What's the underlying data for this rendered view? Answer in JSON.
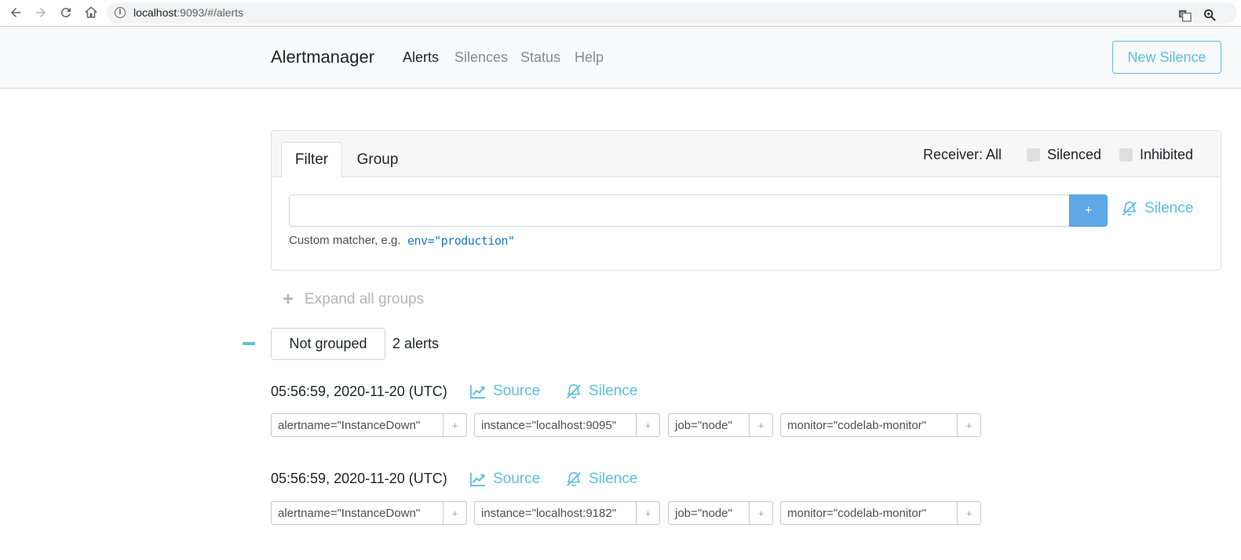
{
  "browser": {
    "url_host": "localhost",
    "url_rest": ":9093/#/alerts"
  },
  "navbar": {
    "brand": "Alertmanager",
    "links": [
      "Alerts",
      "Silences",
      "Status",
      "Help"
    ],
    "active": "Alerts",
    "new_silence_label": "New Silence"
  },
  "filter_card": {
    "tabs": [
      "Filter",
      "Group"
    ],
    "active_tab": "Filter",
    "receiver_label": "Receiver: All",
    "silenced_label": "Silenced",
    "inhibited_label": "Inhibited",
    "input_value": "",
    "add_button_label": "+",
    "silence_label": "Silence",
    "hint_text": "Custom matcher, e.g.",
    "hint_example": "env=\"production\""
  },
  "expand_all_label": "Expand all groups",
  "group": {
    "label": "Not grouped",
    "count_text": "2 alerts"
  },
  "alerts": [
    {
      "time": "05:56:59, 2020-11-20 (UTC)",
      "source_label": "Source",
      "silence_label": "Silence",
      "labels": [
        "alertname=\"InstanceDown\"",
        "instance=\"localhost:9095\"",
        "job=\"node\"",
        "monitor=\"codelab-monitor\""
      ]
    },
    {
      "time": "05:56:59, 2020-11-20 (UTC)",
      "source_label": "Source",
      "silence_label": "Silence",
      "labels": [
        "alertname=\"InstanceDown\"",
        "instance=\"localhost:9182\"",
        "job=\"node\"",
        "monitor=\"codelab-monitor\""
      ]
    }
  ],
  "label_plus": "+",
  "colors": {
    "info": "#5bc0de",
    "primary_btn": "#5fa9e8",
    "code": "#1b75c9"
  },
  "icons": [
    "back-arrow-icon",
    "forward-arrow-icon",
    "reload-icon",
    "home-icon",
    "info-icon",
    "translate-icon",
    "zoom-icon",
    "bell-slash-icon",
    "chart-line-icon",
    "plus-icon",
    "minus-icon"
  ]
}
